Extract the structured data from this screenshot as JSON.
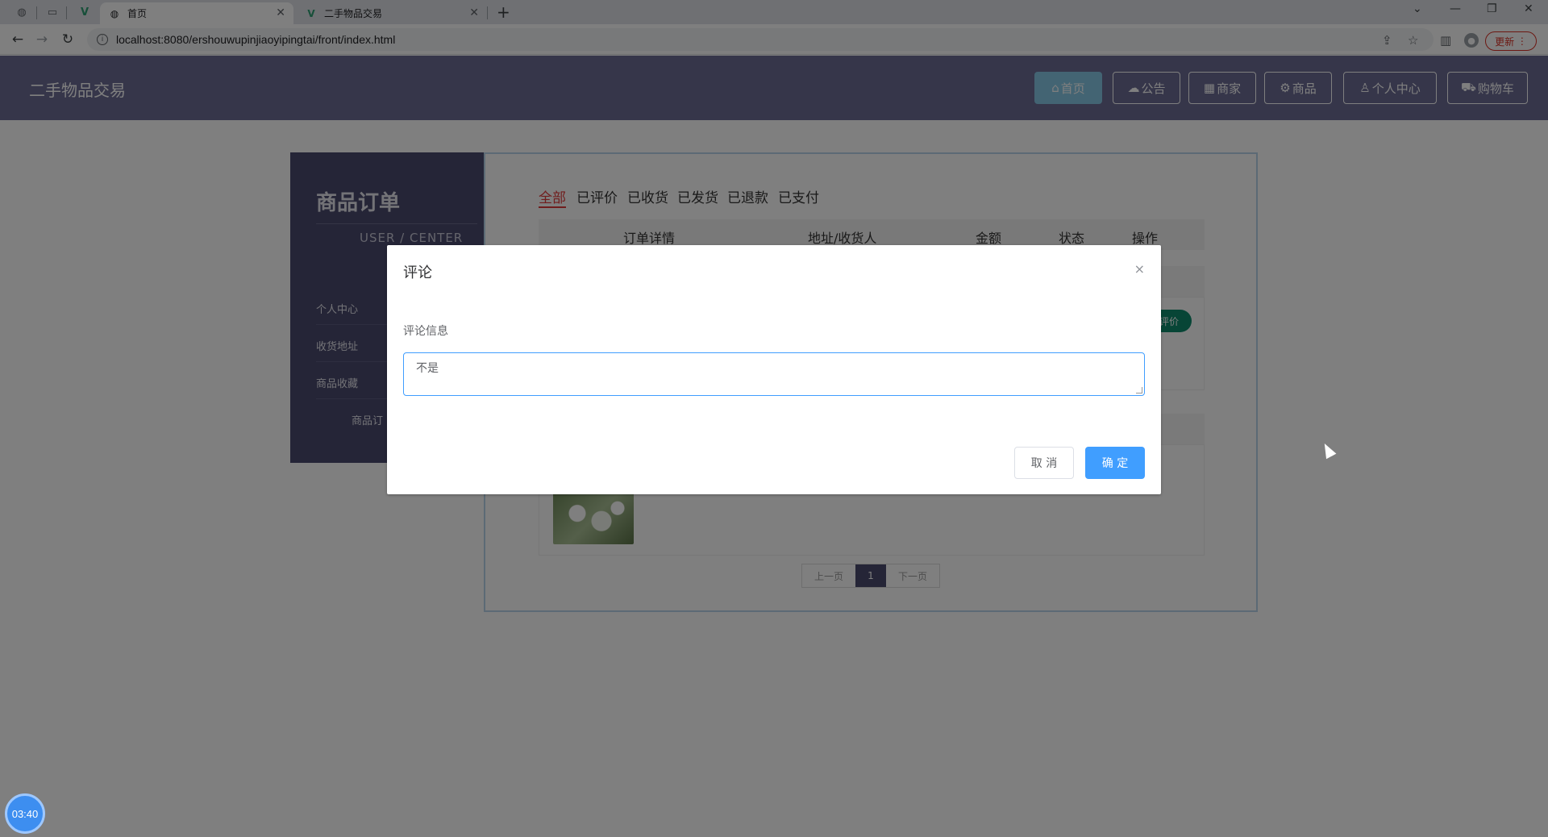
{
  "browser": {
    "tabs": [
      {
        "title": "首页",
        "favicon": "globe-icon"
      },
      {
        "title": "二手物品交易",
        "favicon": "vue-icon"
      }
    ],
    "new_tab_symbol": "+",
    "url": "localhost:8080/ershouwupinjiaoyipingtai/front/index.html",
    "update_label": "更新"
  },
  "site": {
    "logo": "二手物品交易",
    "nav": [
      {
        "label": "首页",
        "icon": "home-icon",
        "active": true
      },
      {
        "label": "公告",
        "icon": "cloud-icon"
      },
      {
        "label": "商家",
        "icon": "grid-icon"
      },
      {
        "label": "商品",
        "icon": "gear-icon"
      },
      {
        "label": "个人中心",
        "icon": "user-icon"
      },
      {
        "label": "购物车",
        "icon": "cart-icon"
      }
    ]
  },
  "sidebar": {
    "title": "商品订单",
    "subtitle": "USER / CENTER",
    "items": [
      "个人中心",
      "收货地址",
      "商品收藏",
      "商品订"
    ]
  },
  "orders": {
    "tabs": [
      "全部",
      "已评价",
      "已收货",
      "已发货",
      "已退款",
      "已支付"
    ],
    "columns": [
      "订单详情",
      "地址/收货人",
      "金额",
      "状态",
      "操作"
    ],
    "review_button": "评价",
    "pager": {
      "prev": "上一页",
      "current": "1",
      "next": "下一页"
    }
  },
  "modal": {
    "title": "评论",
    "field_label": "评论信息",
    "textarea_value": "不是",
    "cancel_label": "取 消",
    "ok_label": "确 定",
    "close_symbol": "×"
  },
  "timer": "03:40",
  "colors": {
    "header_bg": "#6c6c94",
    "nav_active": "#87c9e6",
    "sidebar_bg": "#4b4b6e",
    "primary": "#409eff",
    "tab_active": "#e13b3b"
  }
}
